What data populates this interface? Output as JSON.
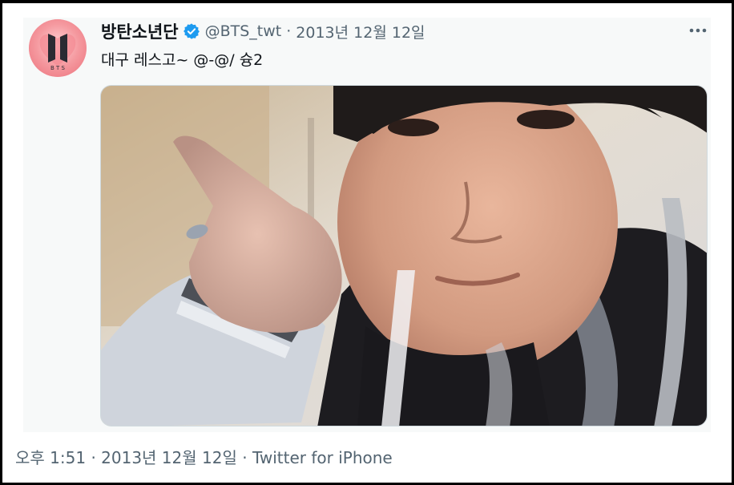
{
  "tweet": {
    "display_name": "방탄소년단",
    "handle": "@BTS_twt",
    "separator": "·",
    "date": "2013년 12월 12일",
    "text": "대구 레스고~ @-@/ 슝2",
    "avatar_logo_text": "B T S"
  },
  "footer": {
    "time": "오후 1:51",
    "separator": "·",
    "date": "2013년 12월 12일",
    "source": "Twitter for iPhone"
  },
  "colors": {
    "verified": "#1d9bf0",
    "text_primary": "#0f1419",
    "text_secondary": "#536471",
    "card_background": "#f7f9f9"
  },
  "icons": {
    "verified": "verified-badge-icon",
    "more": "more-options-icon"
  }
}
